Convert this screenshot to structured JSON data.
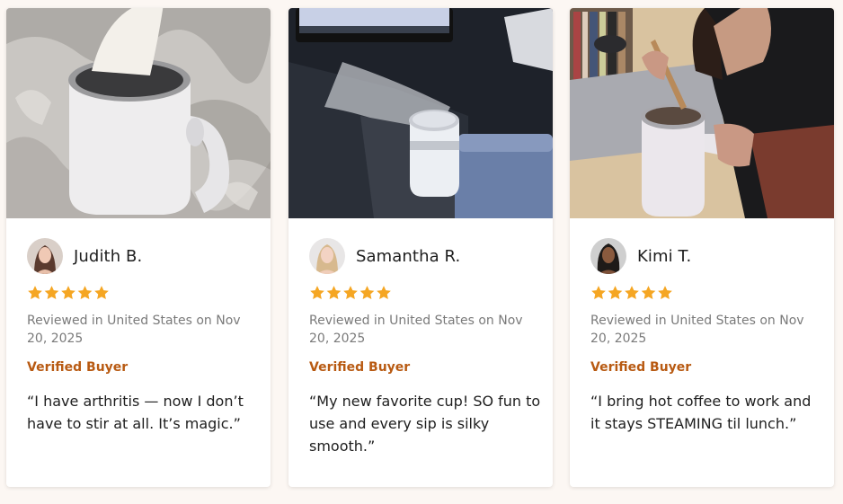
{
  "reviews": [
    {
      "name": "Judith B.",
      "rating": 5,
      "reviewed": "Reviewed in United States on Nov 20, 2025",
      "verified": "Verified Buyer",
      "quote": "“I have arthritis — now I don’t have to stir at all. It’s magic.”"
    },
    {
      "name": "Samantha R.",
      "rating": 5,
      "reviewed": "Reviewed in United States on Nov 20, 2025",
      "verified": "Verified Buyer",
      "quote": "“My new favorite cup! SO fun to use and every sip is silky smooth.”"
    },
    {
      "name": "Kimi T.",
      "rating": 5,
      "reviewed": "Reviewed in United States on Nov 20, 2025",
      "verified": "Verified Buyer",
      "quote": "“I bring hot coffee to work and it stays STEAMING til lunch.”"
    }
  ],
  "colors": {
    "background": "#fcf7f3",
    "star": "#f5a623",
    "verified": "#b85a12"
  }
}
